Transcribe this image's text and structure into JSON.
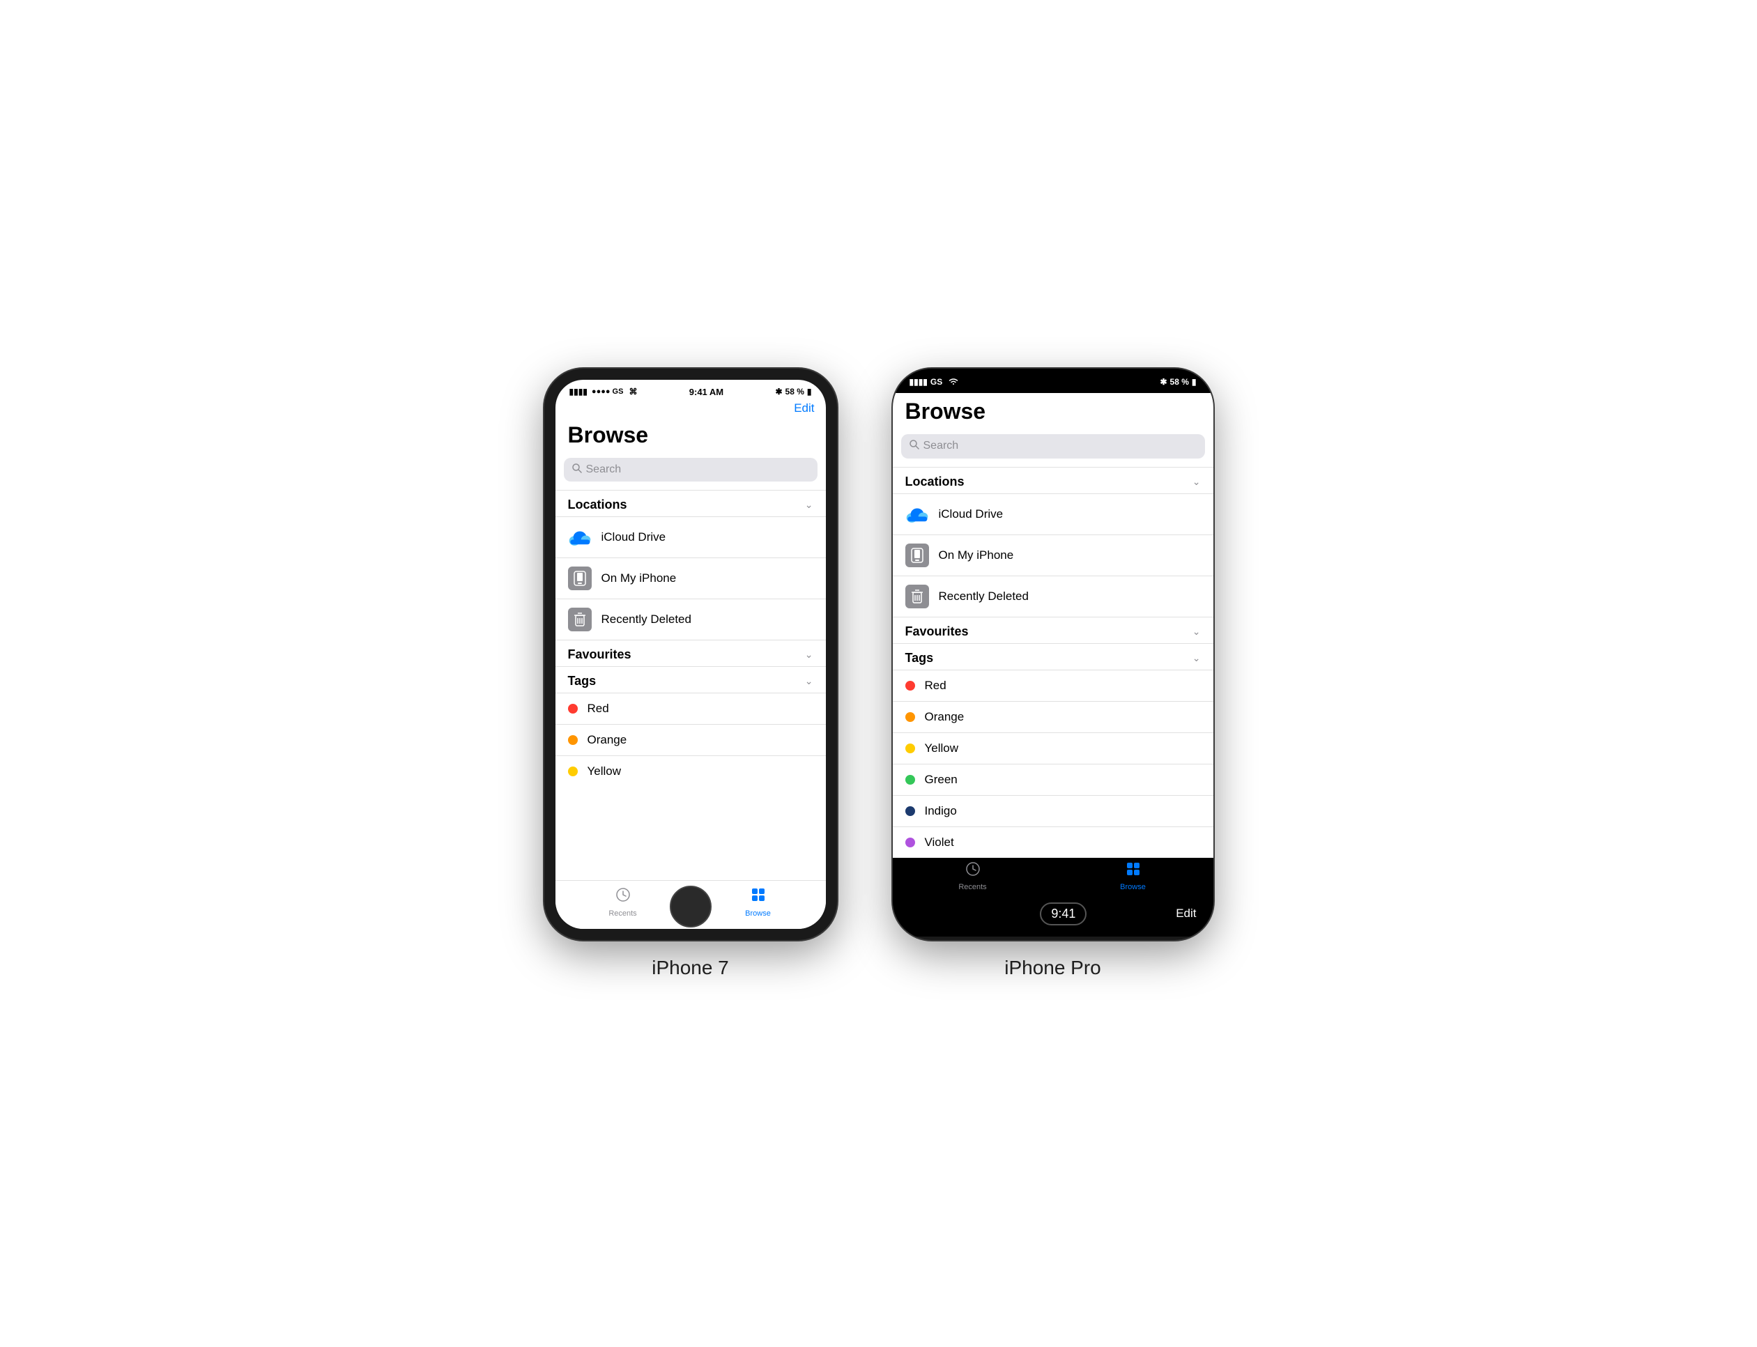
{
  "iphone7": {
    "label": "iPhone 7",
    "status": {
      "signal": "●●●● GS",
      "wifi": "▲",
      "time": "9:41 AM",
      "bluetooth": "✱",
      "battery": "58 %"
    },
    "edit_label": "Edit",
    "title": "Browse",
    "search_placeholder": "Search",
    "sections": {
      "locations": {
        "header": "Locations",
        "items": [
          {
            "name": "iCloud Drive",
            "icon": "cloud"
          },
          {
            "name": "On My iPhone",
            "icon": "phone"
          },
          {
            "name": "Recently Deleted",
            "icon": "trash"
          }
        ]
      },
      "favourites": {
        "header": "Favourites"
      },
      "tags": {
        "header": "Tags",
        "items": [
          {
            "name": "Red",
            "color": "#FF3B30"
          },
          {
            "name": "Orange",
            "color": "#FF9500"
          },
          {
            "name": "Yellow",
            "color": "#FFCC00"
          }
        ]
      }
    },
    "tabs": [
      {
        "label": "Recents",
        "active": false
      },
      {
        "label": "Browse",
        "active": true
      }
    ]
  },
  "iphone_pro": {
    "label": "iPhone Pro",
    "status": {
      "signal": "●●●● GS",
      "wifi": "▲",
      "bluetooth": "✱",
      "battery": "58 %"
    },
    "title": "Browse",
    "search_placeholder": "Search",
    "sections": {
      "locations": {
        "header": "Locations",
        "items": [
          {
            "name": "iCloud Drive",
            "icon": "cloud"
          },
          {
            "name": "On My iPhone",
            "icon": "phone"
          },
          {
            "name": "Recently Deleted",
            "icon": "trash"
          }
        ]
      },
      "favourites": {
        "header": "Favourites"
      },
      "tags": {
        "header": "Tags",
        "items": [
          {
            "name": "Red",
            "color": "#FF3B30"
          },
          {
            "name": "Orange",
            "color": "#FF9500"
          },
          {
            "name": "Yellow",
            "color": "#FFCC00"
          },
          {
            "name": "Green",
            "color": "#34C759"
          },
          {
            "name": "Indigo",
            "color": "#1C3A6E"
          },
          {
            "name": "Violet",
            "color": "#AF52DE"
          }
        ]
      }
    },
    "bottom": {
      "time": "9:41",
      "edit_label": "Edit"
    },
    "tabs": [
      {
        "label": "Recents",
        "active": false
      },
      {
        "label": "Browse",
        "active": true
      }
    ]
  }
}
